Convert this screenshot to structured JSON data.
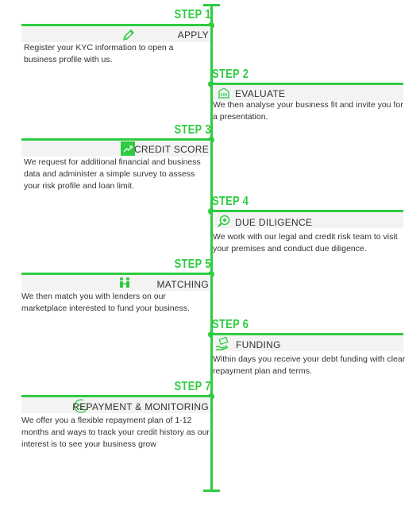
{
  "colors": {
    "accent": "#2ecc40",
    "band": "#f3f3f3",
    "text": "#333333"
  },
  "steps": [
    {
      "label": "STEP 1",
      "title": "APPLY",
      "icon": "pencil-icon",
      "text": "Register your KYC information to open a business profile with us."
    },
    {
      "label": "STEP 2",
      "title": "EVALUATE",
      "icon": "building-icon",
      "text": "We then analyse your business fit and invite you for a presentation."
    },
    {
      "label": "STEP 3",
      "title": "CREDIT SCORE",
      "icon": "chart-trend-icon",
      "text": "We request for additional financial and business data and administer a simple survey to assess your risk profile and loan limit."
    },
    {
      "label": "STEP 4",
      "title": "DUE DILIGENCE",
      "icon": "magnifier-eye-icon",
      "text": "We work with our legal and credit risk team to visit your premises and conduct due diligence."
    },
    {
      "label": "STEP 5",
      "title": "MATCHING",
      "icon": "people-icon",
      "text": "We then match you with lenders on our marketplace interested to fund your business."
    },
    {
      "label": "STEP 6",
      "title": "FUNDING",
      "icon": "hand-money-icon",
      "text": "Within days you receive your debt funding with clear repayment plan and terms."
    },
    {
      "label": "STEP 7",
      "title": "REPAYMENT & MONITORING",
      "icon": "dollar-cycle-icon",
      "text": "We offer you a flexible repayment plan of 1-12 months and ways to track your credit history as our interest is to see your business grow"
    }
  ]
}
